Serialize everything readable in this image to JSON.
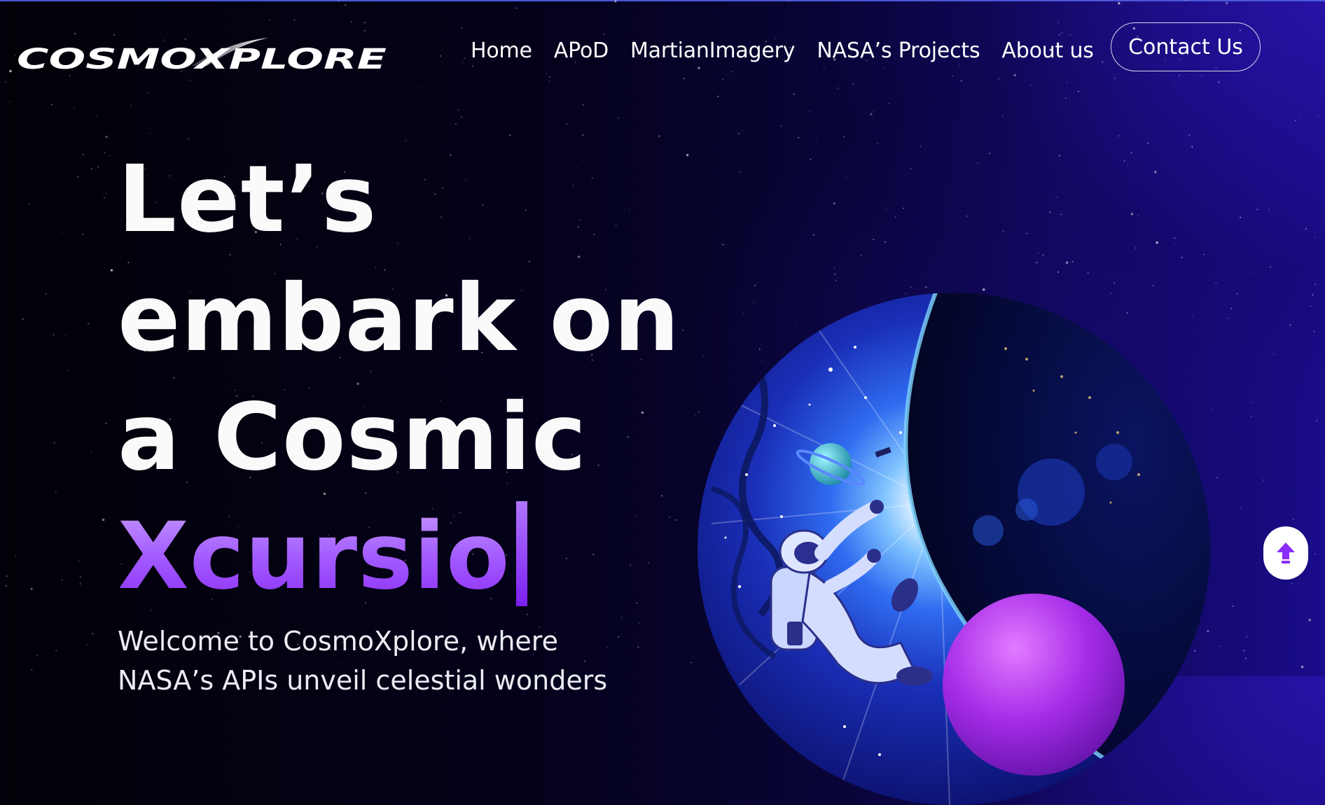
{
  "brand": {
    "name": "COSMOXPLORE"
  },
  "nav": {
    "items": [
      {
        "label": "Home"
      },
      {
        "label": "APoD"
      },
      {
        "label": "MartianImagery"
      },
      {
        "label": "NASA’s Projects"
      },
      {
        "label": "About us"
      }
    ],
    "contact_label": "Contact Us"
  },
  "hero": {
    "line1": "Let’s",
    "line2": "embark on",
    "line3": "a Cosmic",
    "typed_word": "Xcursio",
    "subtitle_line1": "Welcome to CosmoXplore, where",
    "subtitle_line2": "NASA’s APIs unveil celestial wonders"
  },
  "illustration": {
    "icon": "astronaut-in-space-illustration"
  },
  "scroll_top": {
    "icon": "arrow-up-icon"
  },
  "colors": {
    "accent_purple": "#9b4dff",
    "background_dark": "#04021a",
    "background_blue": "#1a0c8a"
  }
}
